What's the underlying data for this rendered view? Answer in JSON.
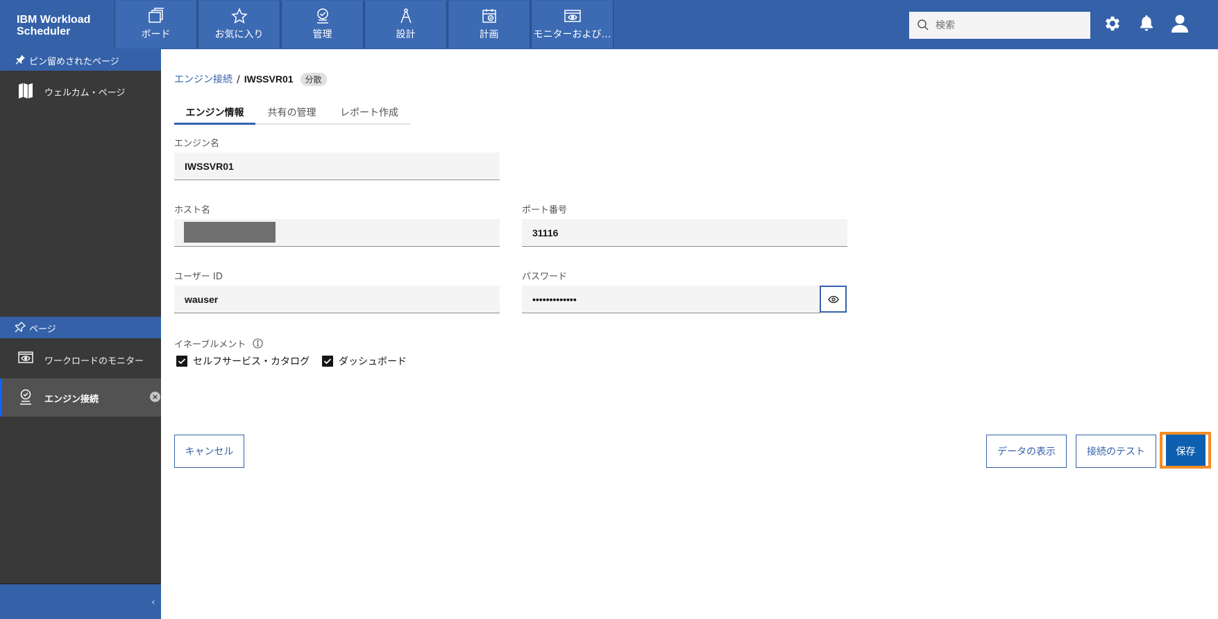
{
  "app": {
    "title_line1": "IBM Workload",
    "title_line2": "Scheduler"
  },
  "nav": {
    "tabs": [
      {
        "label": "ボード",
        "icon": "board-icon"
      },
      {
        "label": "お気に入り",
        "icon": "star-icon"
      },
      {
        "label": "管理",
        "icon": "admin-icon"
      },
      {
        "label": "設計",
        "icon": "design-icon"
      },
      {
        "label": "計画",
        "icon": "plan-icon"
      },
      {
        "label": "モニターおよび…",
        "icon": "monitor-icon"
      }
    ],
    "search_placeholder": "検索"
  },
  "sidebar": {
    "pinned_header": "ピン留めされたページ",
    "pinned_items": [
      {
        "label": "ウェルカム・ページ",
        "icon": "map-icon"
      }
    ],
    "pages_header": "ページ",
    "page_items": [
      {
        "label": "ワークロードのモニター",
        "icon": "eye-monitor-icon"
      },
      {
        "label": "エンジン接続",
        "icon": "engine-connection-icon",
        "active": true
      }
    ],
    "close_glyph": "×",
    "collapse_glyph": "‹"
  },
  "breadcrumb": {
    "link": "エンジン接続",
    "separator": "/",
    "current": "IWSSVR01",
    "tag": "分散"
  },
  "tabs": [
    {
      "label": "エンジン情報",
      "active": true
    },
    {
      "label": "共有の管理",
      "active": false
    },
    {
      "label": "レポート作成",
      "active": false
    }
  ],
  "form": {
    "engine_name_label": "エンジン名",
    "engine_name_value": "IWSSVR01",
    "host_label": "ホスト名",
    "port_label": "ポート番号",
    "port_value": "31116",
    "user_label": "ユーザー ID",
    "user_value": "wauser",
    "password_label": "パスワード",
    "password_value": "•••••••••••••",
    "enablement_label": "イネーブルメント",
    "checkboxes": [
      {
        "label": "セルフサービス・カタログ",
        "checked": true
      },
      {
        "label": "ダッシュボード",
        "checked": true
      }
    ]
  },
  "buttons": {
    "cancel": "キャンセル",
    "show_data": "データの表示",
    "test_connection": "接続のテスト",
    "save": "保存"
  },
  "colors": {
    "header": "#3461a8",
    "sidebar": "#393939",
    "primary": "#0f5fb0",
    "highlight": "#f68d24"
  }
}
